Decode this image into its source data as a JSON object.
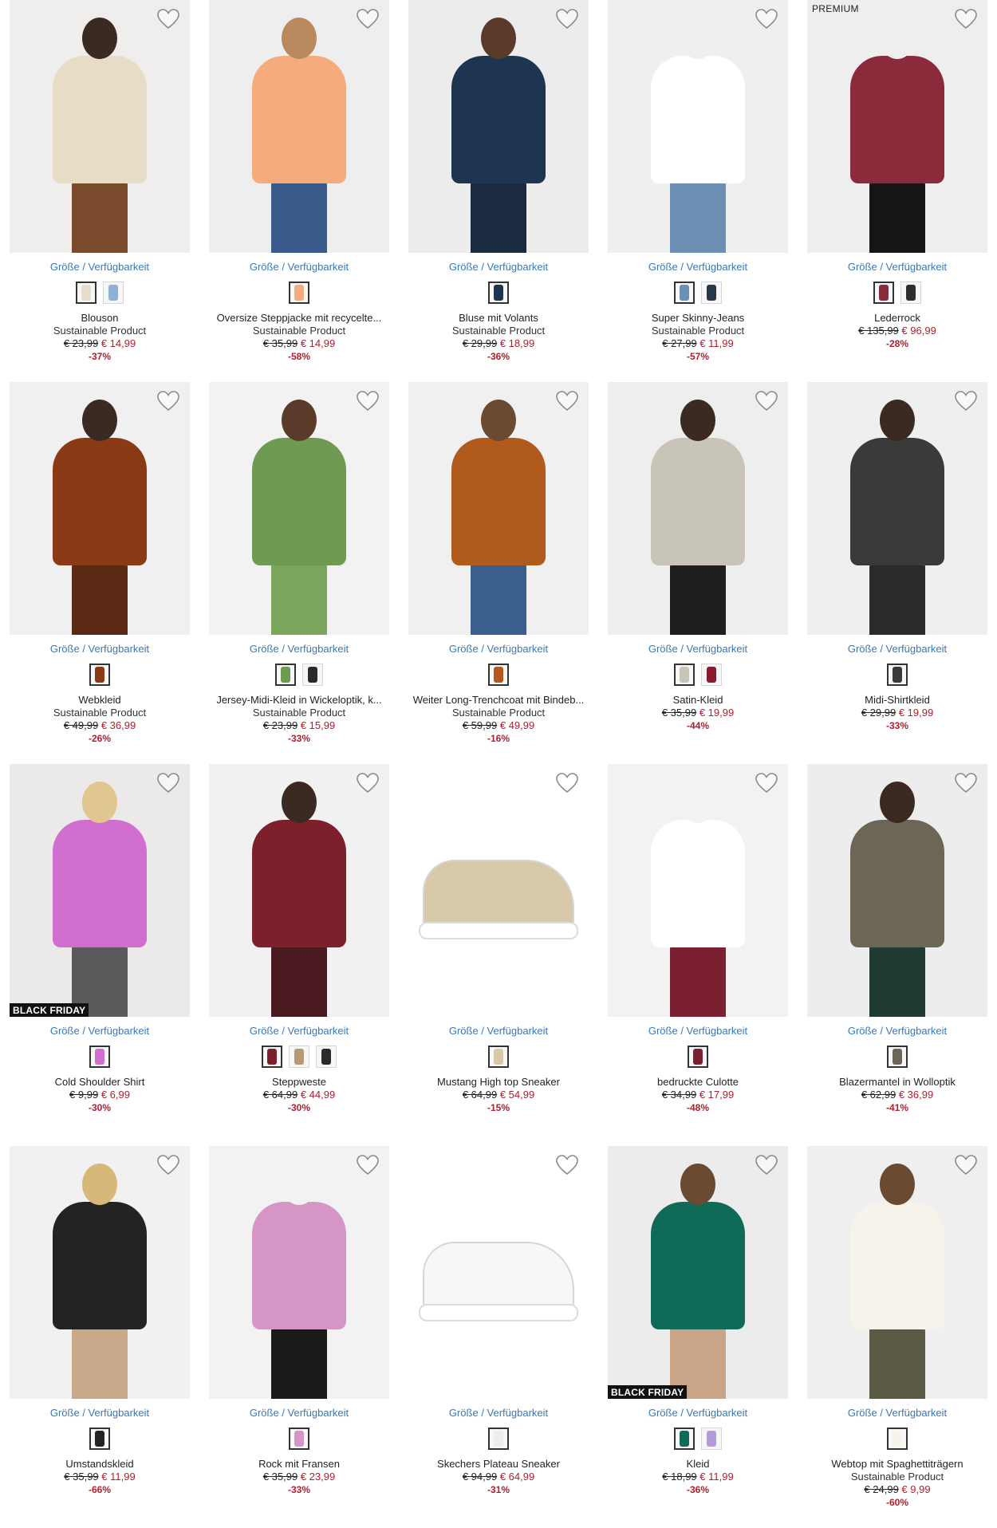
{
  "labels": {
    "availability": "Größe / Verfügbarkeit"
  },
  "colors": {
    "link": "#3a78b5",
    "sale": "#b01f2e",
    "badge_bg": "#111111"
  },
  "products": [
    {
      "name": "Blouson",
      "sub": "Sustainable Product",
      "old": "€ 23,99",
      "new": "€ 14,99",
      "disc": "-37%",
      "badge": "",
      "corner": "",
      "bg": "#efeeec",
      "top": "#e7dcc5",
      "legs": "#7a4a2c",
      "head": "#3b2a22",
      "swatches": [
        "#e7dcc5",
        "#8fb1d8"
      ]
    },
    {
      "name": "Oversize Steppjacke mit recycelte...",
      "sub": "Sustainable Product",
      "old": "€ 35,99",
      "new": "€ 14,99",
      "disc": "-58%",
      "badge": "",
      "corner": "",
      "bg": "#eeeeee",
      "top": "#f6ab7d",
      "legs": "#3a5a8c",
      "head": "#b98a5e",
      "swatches": [
        "#f6ab7d"
      ]
    },
    {
      "name": "Bluse mit Volants",
      "sub": "Sustainable Product",
      "old": "€ 29,99",
      "new": "€ 18,99",
      "disc": "-36%",
      "badge": "",
      "corner": "",
      "bg": "#ececec",
      "top": "#1d3550",
      "legs": "#1a2b40",
      "head": "#5a3a28",
      "swatches": [
        "#1d3550"
      ]
    },
    {
      "name": "Super Skinny-Jeans",
      "sub": "Sustainable Product",
      "old": "€ 27,99",
      "new": "€ 11,99",
      "disc": "-57%",
      "badge": "",
      "corner": "",
      "bg": "#efefef",
      "top": "#ffffff",
      "legs": "#6d8fb4",
      "head": "#efefef",
      "swatches": [
        "#6d8fb4",
        "#283848"
      ]
    },
    {
      "name": "Lederrock",
      "sub": "",
      "old": "€ 135,99",
      "new": "€ 96,99",
      "disc": "-28%",
      "badge": "",
      "corner": "PREMIUM",
      "bg": "#eeeeee",
      "top": "#8b2a3a",
      "legs": "#151515",
      "head": "#eeeeee",
      "swatches": [
        "#8b2a3a",
        "#2e2e2e"
      ]
    },
    {
      "name": "Webkleid",
      "sub": "Sustainable Product",
      "old": "€ 49,99",
      "new": "€ 36,99",
      "disc": "-26%",
      "badge": "",
      "corner": "",
      "bg": "#f0f0f0",
      "top": "#8a3b16",
      "legs": "#5a2a14",
      "head": "#3b2a22",
      "swatches": [
        "#8a3b16"
      ]
    },
    {
      "name": "Jersey-Midi-Kleid in Wickeloptik, k...",
      "sub": "Sustainable Product",
      "old": "€ 23,99",
      "new": "€ 15,99",
      "disc": "-33%",
      "badge": "",
      "corner": "",
      "bg": "#f2f2f2",
      "top": "#6f9a52",
      "legs": "#7aa65b",
      "head": "#5a3a28",
      "swatches": [
        "#6f9a52",
        "#2a2a2a"
      ]
    },
    {
      "name": "Weiter Long-Trenchcoat mit Bindeb...",
      "sub": "Sustainable Product",
      "old": "€ 59,99",
      "new": "€ 49,99",
      "disc": "-16%",
      "badge": "",
      "corner": "",
      "bg": "#f0f0f0",
      "top": "#b05a1c",
      "legs": "#3a5f8f",
      "head": "#6a4a30",
      "swatches": [
        "#b05a1c"
      ]
    },
    {
      "name": "Satin-Kleid",
      "sub": "",
      "old": "€ 35,99",
      "new": "€ 19,99",
      "disc": "-44%",
      "badge": "",
      "corner": "",
      "bg": "#eeeeee",
      "top": "#c8c4b8",
      "legs": "#1f1f1f",
      "head": "#3b2a22",
      "swatches": [
        "#c8c4b8",
        "#8b1b2a"
      ]
    },
    {
      "name": "Midi-Shirtkleid",
      "sub": "",
      "old": "€ 29,99",
      "new": "€ 19,99",
      "disc": "-33%",
      "badge": "",
      "corner": "",
      "bg": "#efefef",
      "top": "#3a3a3a",
      "legs": "#2a2a2a",
      "head": "#3b2a22",
      "swatches": [
        "#3a3a3a"
      ]
    },
    {
      "name": "Cold Shoulder Shirt",
      "sub": "",
      "old": "€ 9,99",
      "new": "€ 6,99",
      "disc": "-30%",
      "badge": "BLACK FRIDAY",
      "corner": "",
      "bg": "#eceae8",
      "top": "#d06fd0",
      "legs": "#5a5a5a",
      "head": "#e0c690",
      "swatches": [
        "#d06fd0"
      ]
    },
    {
      "name": "Steppweste",
      "sub": "",
      "old": "€ 64,99",
      "new": "€ 44,99",
      "disc": "-30%",
      "badge": "",
      "corner": "",
      "bg": "#f1f1f1",
      "top": "#7e1f2c",
      "legs": "#4a1a20",
      "head": "#3b2a22",
      "swatches": [
        "#7e1f2c",
        "#b79a74",
        "#2a2a2a"
      ]
    },
    {
      "name": "Mustang High top Sneaker",
      "sub": "",
      "old": "€ 64,99",
      "new": "€ 54,99",
      "disc": "-15%",
      "badge": "",
      "corner": "",
      "bg": "#ffffff",
      "top": "#d8c9a8",
      "legs": "",
      "head": "",
      "shoe": true,
      "swatches": [
        "#d8c9a8"
      ]
    },
    {
      "name": "bedruckte Culotte",
      "sub": "",
      "old": "€ 34,99",
      "new": "€ 17,99",
      "disc": "-48%",
      "badge": "",
      "corner": "",
      "bg": "#f2f2f2",
      "top": "#ffffff",
      "legs": "#7a2030",
      "head": "#f2f2f2",
      "swatches": [
        "#7a2030"
      ]
    },
    {
      "name": "Blazermantel in Wolloptik",
      "sub": "",
      "old": "€ 62,99",
      "new": "€ 36,99",
      "disc": "-41%",
      "badge": "",
      "corner": "",
      "bg": "#ededed",
      "top": "#6b6656",
      "legs": "#1f3b33",
      "head": "#3b2a22",
      "swatches": [
        "#6b6656"
      ]
    },
    {
      "name": "Umstandskleid",
      "sub": "",
      "old": "€ 35,99",
      "new": "€ 11,99",
      "disc": "-66%",
      "badge": "",
      "corner": "",
      "bg": "#f1f1f1",
      "top": "#232323",
      "legs": "#caa88a",
      "head": "#d8b878",
      "swatches": [
        "#232323"
      ]
    },
    {
      "name": "Rock mit Fransen",
      "sub": "",
      "old": "€ 35,99",
      "new": "€ 23,99",
      "disc": "-33%",
      "badge": "",
      "corner": "",
      "bg": "#f2f2f2",
      "top": "#d596c6",
      "legs": "#1a1a1a",
      "head": "#f2f2f2",
      "swatches": [
        "#d596c6"
      ]
    },
    {
      "name": "Skechers Plateau Sneaker",
      "sub": "",
      "old": "€ 94,99",
      "new": "€ 64,99",
      "disc": "-31%",
      "badge": "",
      "corner": "",
      "bg": "#ffffff",
      "top": "#f7f7f7",
      "legs": "",
      "head": "",
      "shoe": true,
      "swatches": [
        "#eeeeee"
      ]
    },
    {
      "name": "Kleid",
      "sub": "",
      "old": "€ 18,99",
      "new": "€ 11,99",
      "disc": "-36%",
      "badge": "BLACK FRIDAY",
      "corner": "",
      "bg": "#ececec",
      "top": "#0f6b57",
      "legs": "#c9a487",
      "head": "#6a4a30",
      "swatches": [
        "#0f6b57",
        "#b59ad8"
      ]
    },
    {
      "name": "Webtop mit Spaghettiträgern",
      "sub": "Sustainable Product",
      "old": "€ 24,99",
      "new": "€ 9,99",
      "disc": "-60%",
      "badge": "",
      "corner": "",
      "bg": "#efefef",
      "top": "#f6f3ea",
      "legs": "#5a5a44",
      "head": "#6a4a30",
      "swatches": [
        "#f6f3ea"
      ]
    }
  ]
}
